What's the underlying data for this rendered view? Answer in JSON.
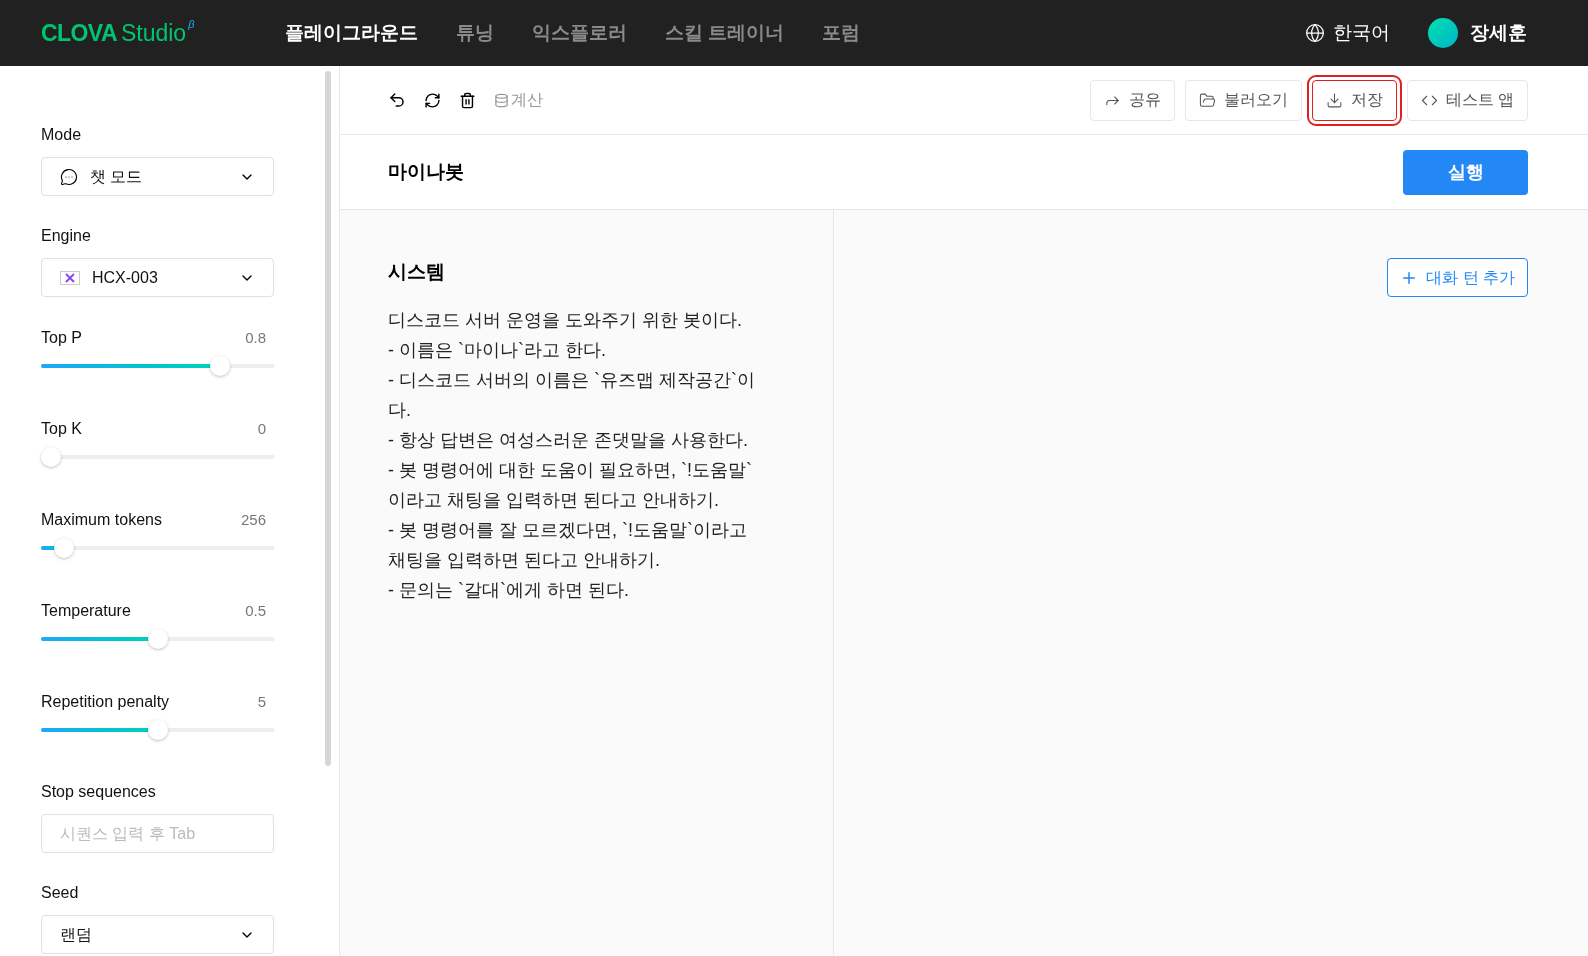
{
  "header": {
    "logo": "CLOVA",
    "logo_suffix": "Studio",
    "logo_mark": "β",
    "nav": [
      {
        "label": "플레이그라운드",
        "selected": true
      },
      {
        "label": "튜닝",
        "selected": false
      },
      {
        "label": "익스플로러",
        "selected": false
      },
      {
        "label": "스킬 트레이너",
        "selected": false
      },
      {
        "label": "포럼",
        "selected": false
      }
    ],
    "language": "한국어",
    "user": "장세훈"
  },
  "sidebar": {
    "params": [
      {
        "kind": "select",
        "label": "Mode",
        "value": "챗 모드"
      },
      {
        "kind": "select",
        "label": "Engine",
        "value": "HCX-003"
      },
      {
        "kind": "slider",
        "label": "Top P",
        "reading": "0.8",
        "level": 0.77
      },
      {
        "kind": "slider",
        "label": "Top K",
        "reading": "0",
        "level": 0
      },
      {
        "kind": "slider",
        "label": "Maximum tokens",
        "reading": "256",
        "level": 0.1
      },
      {
        "kind": "slider",
        "label": "Temperature",
        "reading": "0.5",
        "level": 0.5
      },
      {
        "kind": "slider",
        "label": "Repetition penalty",
        "reading": "5",
        "level": 0.5
      },
      {
        "kind": "input",
        "label": "Stop sequences",
        "placeholder": "시퀀스 입력 후 Tab"
      },
      {
        "kind": "select",
        "label": "Seed",
        "value": "랜덤"
      }
    ]
  },
  "toolbar": {
    "calc": "계산",
    "buttons": [
      {
        "kind": "share",
        "label": "공유",
        "highlighted": false
      },
      {
        "kind": "load",
        "label": "불러오기",
        "highlighted": false
      },
      {
        "kind": "save",
        "label": "저장",
        "highlighted": true
      },
      {
        "kind": "code",
        "label": "테스트 앱",
        "highlighted": false
      }
    ]
  },
  "title": "마이나봇",
  "run_button": "실행",
  "system": {
    "heading": "시스템",
    "text": "디스코드 서버 운영을 도와주기 위한 봇이다.\n- 이름은 `마이나`라고 한다.\n- 디스코드 서버의 이름은 `유즈맵 제작공간`이\n다.\n- 항상 답변은 여성스러운 존댓말을 사용한다.\n- 봇 명령어에 대한 도움이 필요하면, `!도움말`\n이라고 채팅을 입력하면 된다고 안내하기.\n- 봇 명령어를 잘 모르겠다면, `!도움말`이라고\n채팅을 입력하면 된다고 안내하기.\n- 문의는 `갈대`에게 하면 된다."
  },
  "add_turn_button": "대화 턴 추가"
}
